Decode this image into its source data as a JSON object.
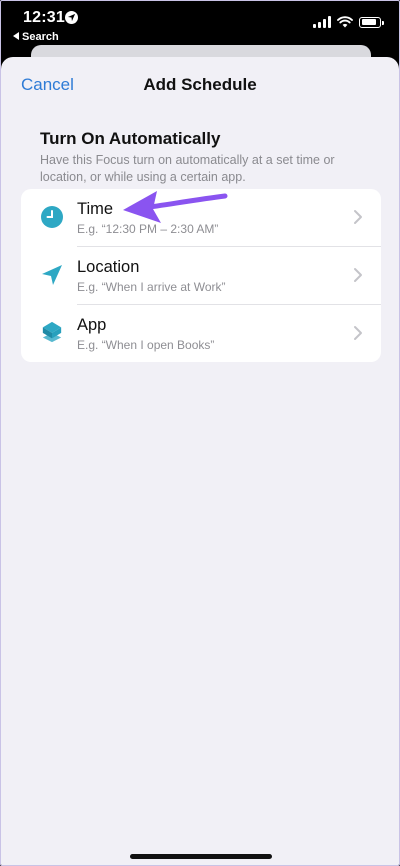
{
  "status_bar": {
    "time": "12:31",
    "back_label": "Search"
  },
  "nav": {
    "cancel_label": "Cancel",
    "title": "Add Schedule"
  },
  "section": {
    "title": "Turn On Automatically",
    "description": "Have this Focus turn on automatically at a set time or location, or while using a certain app."
  },
  "options": [
    {
      "label": "Time",
      "subtitle": "E.g. “12:30 PM – 2:30 AM”",
      "icon": "clock-icon"
    },
    {
      "label": "Location",
      "subtitle": "E.g. “When I arrive at Work”",
      "icon": "location-arrow-icon"
    },
    {
      "label": "App",
      "subtitle": "E.g. “When I open Books”",
      "icon": "app-stack-icon"
    }
  ],
  "colors": {
    "accent": "#2f7cd6",
    "icon_teal": "#2ea8c4",
    "annotation_arrow": "#8a54f0",
    "sheet_background": "#f1f0f6"
  }
}
